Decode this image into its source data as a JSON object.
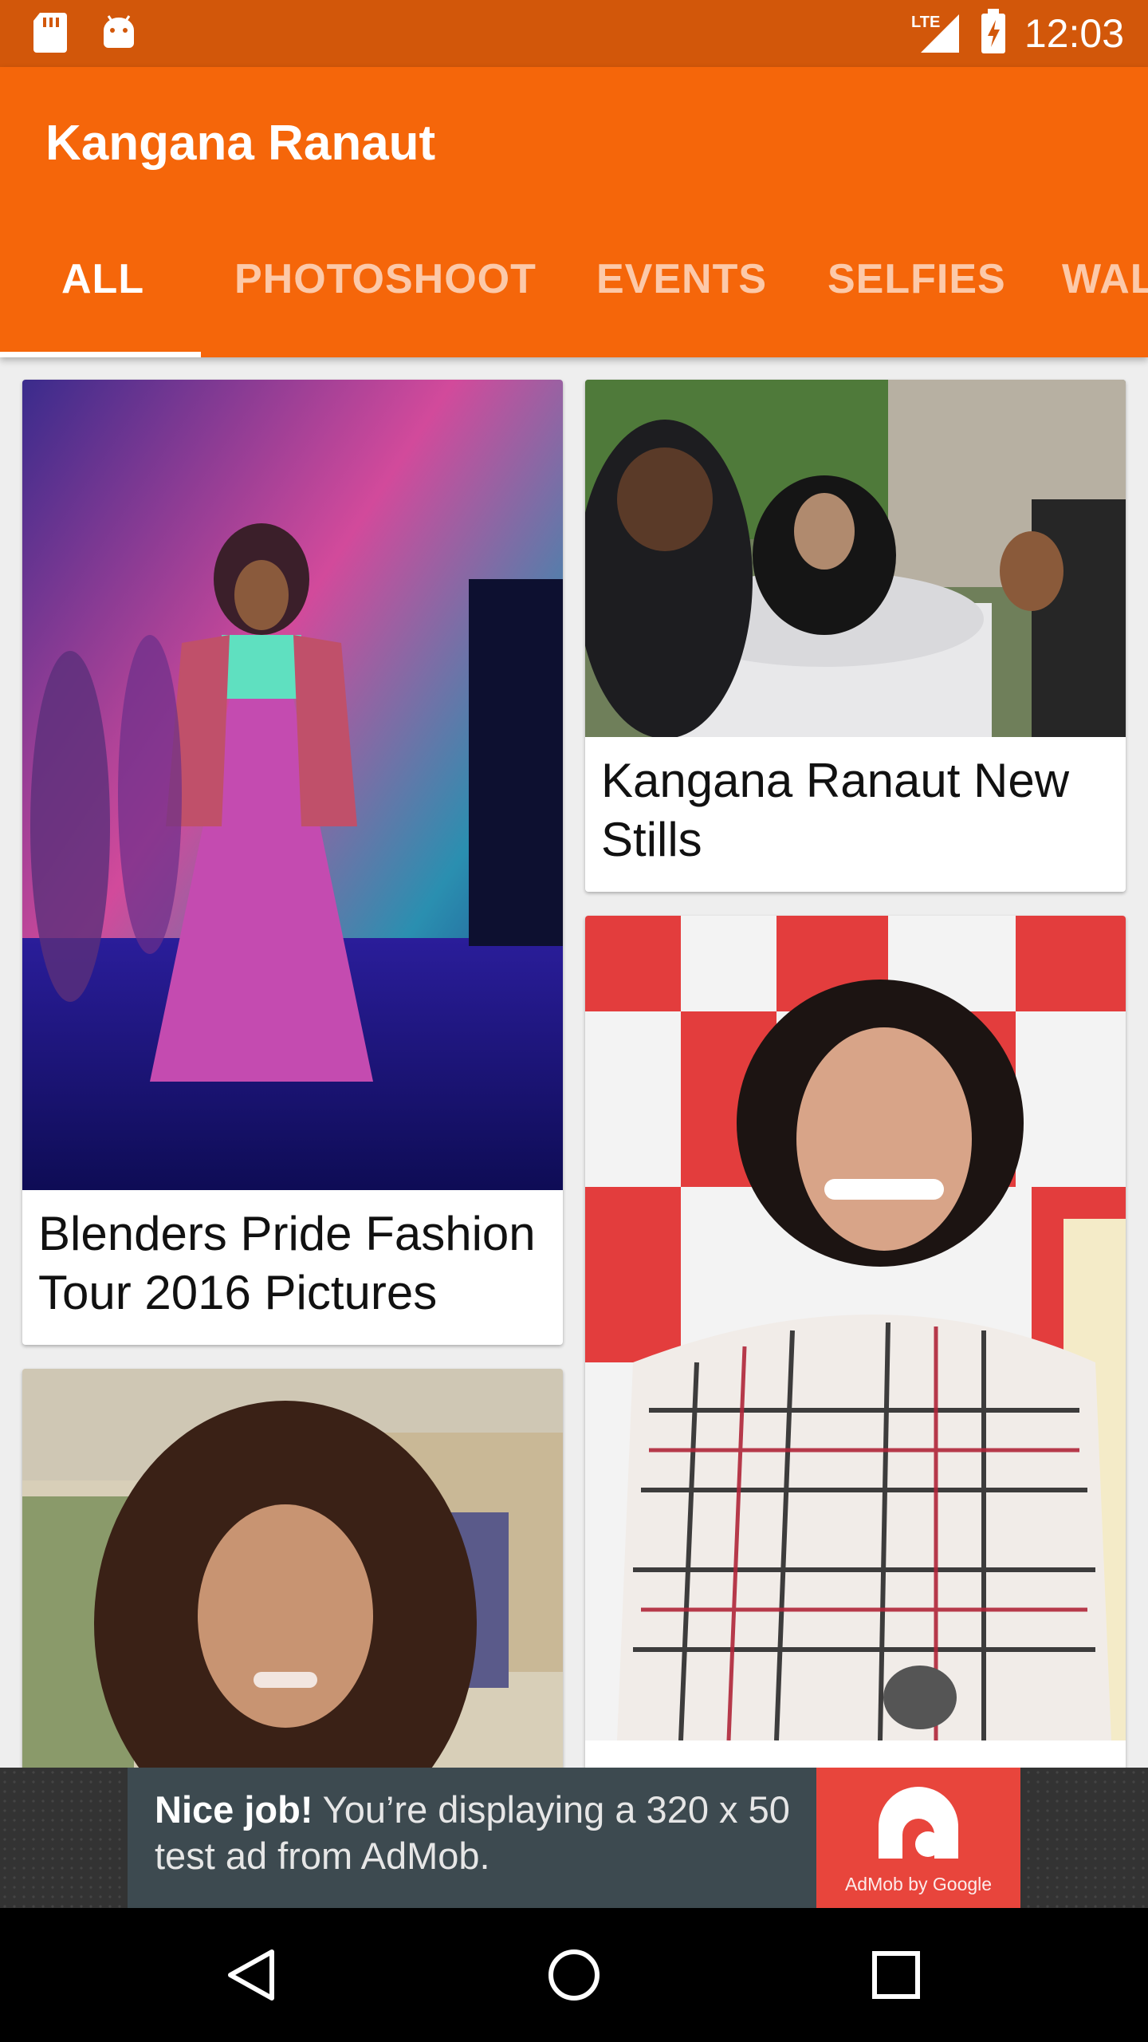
{
  "status_bar": {
    "time": "12:03",
    "network": "LTE",
    "left_icons": [
      "sd-card-icon",
      "android-icon"
    ],
    "right_icons": [
      "signal-icon",
      "battery-charging-icon"
    ]
  },
  "app_bar": {
    "title": "Kangana Ranaut",
    "background": "#f5660a",
    "status_background": "#d2570a"
  },
  "tabs": [
    {
      "label": "ALL",
      "active": true
    },
    {
      "label": "PHOTOSHOOT",
      "active": false
    },
    {
      "label": "EVENTS",
      "active": false
    },
    {
      "label": "SELFIES",
      "active": false
    },
    {
      "label": "WAL",
      "active": false
    }
  ],
  "gallery": {
    "cards": [
      {
        "caption": "Blenders Pride Fashion Tour 2016 Pictures",
        "image": "runway-photo"
      },
      {
        "caption": "Kangana Ranaut New Stills",
        "image": "car-crowd-photo"
      },
      {
        "caption": "",
        "image": "curly-hair-portrait-photo"
      },
      {
        "caption": "",
        "image": "femina-event-photo"
      }
    ]
  },
  "ad": {
    "headline": "Nice job!",
    "body": " You’re displaying a 320 x 50 test ad from AdMob.",
    "brand": "AdMob by Google"
  },
  "nav_bar": {
    "buttons": [
      "back-icon",
      "home-icon",
      "recents-icon"
    ]
  }
}
